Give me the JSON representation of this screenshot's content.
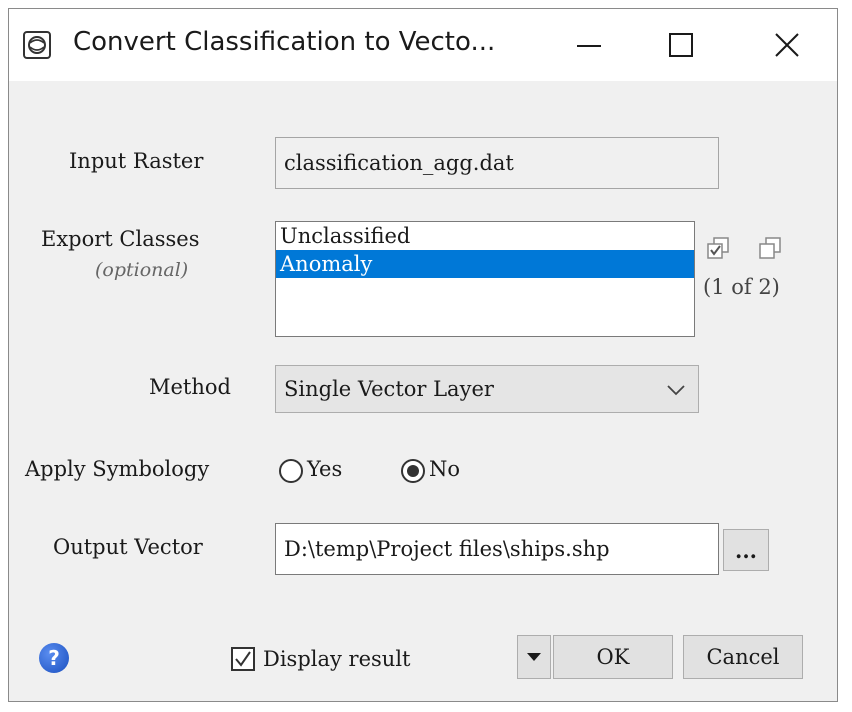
{
  "window": {
    "title": "Convert Classification to Vecto...",
    "icon": "envi-app-icon"
  },
  "input_raster": {
    "label": "Input Raster",
    "value": "classification_agg.dat"
  },
  "export_classes": {
    "label": "Export Classes",
    "sublabel": "(optional)",
    "items": [
      {
        "label": "Unclassified",
        "selected": false
      },
      {
        "label": "Anomaly",
        "selected": true
      }
    ],
    "count_text": "(1 of 2)"
  },
  "method": {
    "label": "Method",
    "value": "Single Vector Layer"
  },
  "apply_symbology": {
    "label": "Apply Symbology",
    "yes_label": "Yes",
    "no_label": "No",
    "selected": "No"
  },
  "output_vector": {
    "label": "Output Vector",
    "value": "D:\\temp\\Project files\\ships.shp",
    "browse_label": "..."
  },
  "footer": {
    "help_label": "?",
    "display_result_label": "Display result",
    "display_result_checked": true,
    "ok_label": "OK",
    "cancel_label": "Cancel"
  },
  "colors": {
    "selection": "#0078d7",
    "help_icon": "#2a5fd0"
  }
}
